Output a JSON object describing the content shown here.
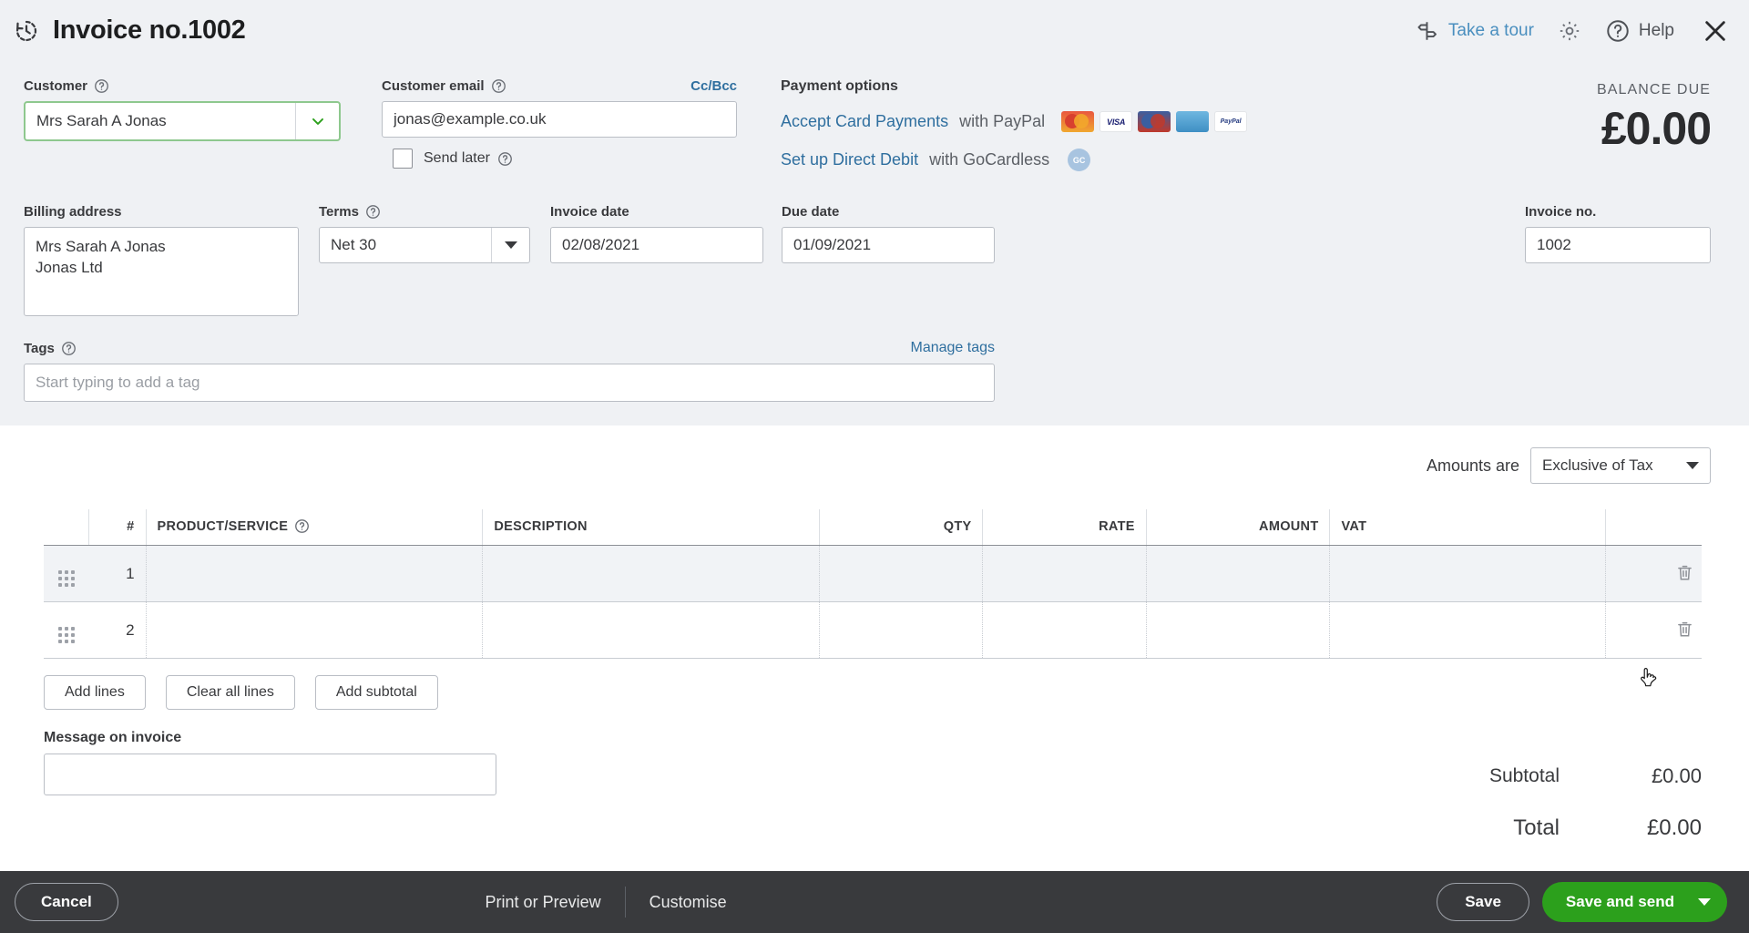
{
  "header": {
    "title": "Invoice no.1002",
    "history_icon": "history-clock-icon",
    "tour_label": "Take a tour",
    "tour_icon": "signpost-icon",
    "gear_icon": "gear-icon",
    "help_label": "Help",
    "help_icon": "question-circle-icon",
    "close_icon": "close-x-icon"
  },
  "customer": {
    "label": "Customer",
    "value": "Mrs Sarah A Jonas",
    "help_icon": "question-mark-icon",
    "dropdown_icon": "chevron-down-icon",
    "accent": "#8ec88e"
  },
  "email": {
    "label": "Customer email",
    "value": "jonas@example.co.uk",
    "ccbcc_label": "Cc/Bcc",
    "send_later_label": "Send later",
    "send_later_checked": false
  },
  "payment_options": {
    "title": "Payment options",
    "card_link": "Accept Card Payments",
    "card_suffix": "with PayPal",
    "debit_link": "Set up Direct Debit",
    "debit_suffix": "with GoCardless",
    "card_logos": [
      "mastercard-logo",
      "visa-logo",
      "maestro-logo",
      "amex-logo",
      "paypal-logo"
    ],
    "card_logo_labels": [
      "",
      "VISA",
      "",
      "",
      "PayPal"
    ],
    "gocardless_badge": "GC",
    "link_color": "#2f6f9f"
  },
  "balance": {
    "label": "BALANCE DUE",
    "amount": "£0.00"
  },
  "billing": {
    "label": "Billing address",
    "line1": "Mrs Sarah A Jonas",
    "line2": "Jonas Ltd"
  },
  "terms": {
    "label": "Terms",
    "value": "Net 30",
    "dropdown_icon": "caret-down-icon"
  },
  "invoice_date": {
    "label": "Invoice date",
    "value": "02/08/2021"
  },
  "due_date": {
    "label": "Due date",
    "value": "01/09/2021"
  },
  "invoice_no": {
    "label": "Invoice no.",
    "value": "1002"
  },
  "tags": {
    "label": "Tags",
    "placeholder": "Start typing to add a tag",
    "value": "",
    "manage_label": "Manage tags"
  },
  "amounts_are": {
    "label": "Amounts are",
    "value": "Exclusive of Tax"
  },
  "line_items": {
    "columns": [
      "#",
      "PRODUCT/SERVICE",
      "DESCRIPTION",
      "QTY",
      "RATE",
      "AMOUNT",
      "VAT"
    ],
    "rows": [
      {
        "num": "1",
        "product": "",
        "description": "",
        "qty": "",
        "rate": "",
        "amount": "",
        "vat": "",
        "hovered": true
      },
      {
        "num": "2",
        "product": "",
        "description": "",
        "qty": "",
        "rate": "",
        "amount": "",
        "vat": "",
        "hovered": false
      }
    ],
    "grip_icon": "drag-handle-icon",
    "trash_icon": "trash-icon"
  },
  "line_buttons": {
    "add_lines": "Add lines",
    "clear_all_lines": "Clear all lines",
    "add_subtotal": "Add subtotal"
  },
  "message": {
    "label": "Message on invoice",
    "value": ""
  },
  "totals": {
    "subtotal_label": "Subtotal",
    "subtotal_value": "£0.00",
    "total_label": "Total",
    "total_value": "£0.00"
  },
  "footer": {
    "cancel": "Cancel",
    "print_preview": "Print or Preview",
    "customise": "Customise",
    "save": "Save",
    "save_and_send": "Save and send",
    "save_send_color": "#2ca01c",
    "dropdown_icon": "caret-down-icon"
  }
}
